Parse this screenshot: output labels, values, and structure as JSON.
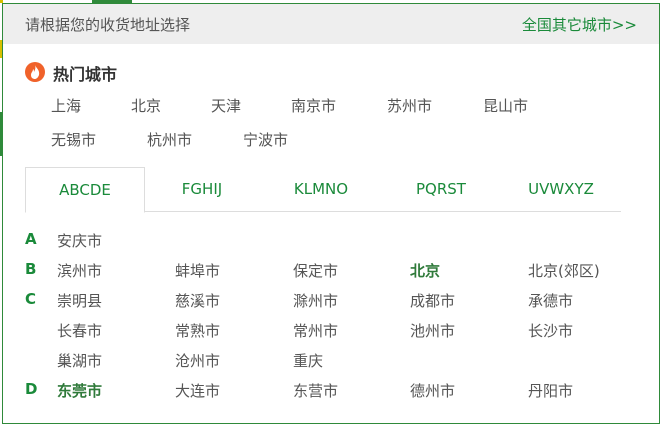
{
  "header": {
    "title": "请根据您的收货地址选择",
    "all_cities_link": "全国其它城市>>"
  },
  "hot": {
    "title": "热门城市",
    "cities": [
      "上海",
      "北京",
      "天津",
      "南京市",
      "苏州市",
      "昆山市",
      "无锡市",
      "杭州市",
      "宁波市"
    ]
  },
  "tabs": [
    "ABCDE",
    "FGHIJ",
    "KLMNO",
    "PQRST",
    "UVWXYZ"
  ],
  "active_tab": "ABCDE",
  "groups": [
    {
      "letter": "A",
      "cities": [
        "安庆市"
      ]
    },
    {
      "letter": "B",
      "cities": [
        "滨州市",
        "蚌埠市",
        "保定市",
        "北京",
        "北京(郊区)"
      ]
    },
    {
      "letter": "C",
      "cities": [
        "崇明县",
        "慈溪市",
        "滁州市",
        "成都市",
        "承德市",
        "长春市",
        "常熟市",
        "常州市",
        "池州市",
        "长沙市",
        "巢湖市",
        "沧州市",
        "重庆"
      ]
    },
    {
      "letter": "D",
      "cities": [
        "东莞市",
        "大连市",
        "东营市",
        "德州市",
        "丹阳市"
      ]
    }
  ],
  "highlighted_cities": [
    "北京",
    "东莞市"
  ],
  "colors": {
    "accent": "#1a8a3a",
    "border": "#2f8a3a",
    "header_bg": "#eeeeee",
    "hot_icon": "#f0622a"
  }
}
